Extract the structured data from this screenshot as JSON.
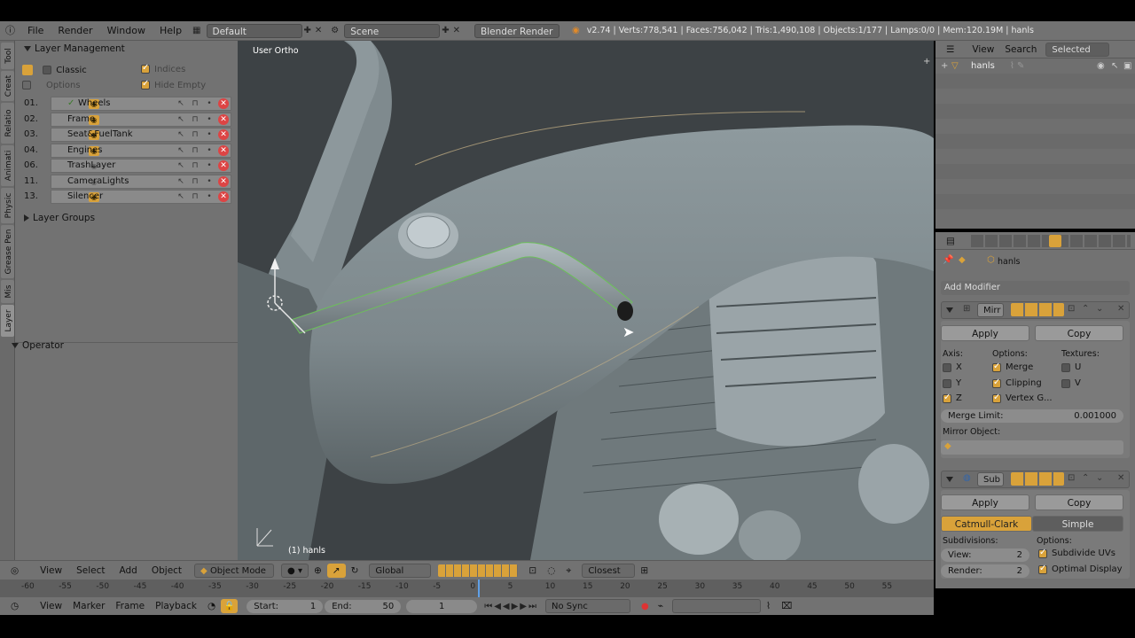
{
  "topbar": {
    "menus": [
      "File",
      "Render",
      "Window",
      "Help"
    ],
    "layout": "Default",
    "scene": "Scene",
    "engine": "Blender Render",
    "stats": "v2.74 | Verts:778,541 | Faces:756,042 | Tris:1,490,108 | Objects:1/177 | Lamps:0/0 | Mem:120.19M | hanls"
  },
  "lefttabs": [
    "Tool",
    "Creat",
    "Relatio",
    "Animati",
    "Physic",
    "Grease Pen",
    "Mis",
    "Layer"
  ],
  "layers": {
    "title": "Layer Management",
    "classic": "Classic",
    "indices": "Indices",
    "options": "Options",
    "hide_empty": "Hide Empty",
    "rows": [
      {
        "num": "01.",
        "name": "Wheels"
      },
      {
        "num": "02.",
        "name": "Frame"
      },
      {
        "num": "03.",
        "name": "Seat&FuelTank"
      },
      {
        "num": "04.",
        "name": "Engines"
      },
      {
        "num": "06.",
        "name": "TrashLayer"
      },
      {
        "num": "11.",
        "name": "CameraLights"
      },
      {
        "num": "13.",
        "name": "Silencer"
      }
    ],
    "groups": "Layer Groups",
    "operator": "Operator"
  },
  "viewport": {
    "view_label": "User Ortho",
    "object_label": "(1) hanls"
  },
  "vpheader": {
    "view": "View",
    "select": "Select",
    "add": "Add",
    "object": "Object",
    "mode": "Object Mode",
    "orientation": "Global",
    "snap": "Closest"
  },
  "timeline": {
    "ticks": [
      "-60",
      "-55",
      "-50",
      "-45",
      "-40",
      "-35",
      "-30",
      "-25",
      "-20",
      "-15",
      "-10",
      "-5",
      "0",
      "5",
      "10",
      "15",
      "20",
      "25",
      "30",
      "35",
      "40",
      "45",
      "50",
      "55"
    ],
    "view": "View",
    "marker": "Marker",
    "frame": "Frame",
    "playback": "Playback",
    "start_label": "Start:",
    "start": "1",
    "end_label": "End:",
    "end": "50",
    "current": "1",
    "sync": "No Sync"
  },
  "outliner": {
    "view": "View",
    "search": "Search",
    "filter": "Selected",
    "item": "hanls"
  },
  "props": {
    "object": "hanls",
    "add_modifier": "Add Modifier",
    "mirror": {
      "name": "Mirr",
      "apply": "Apply",
      "copy": "Copy",
      "axis": "Axis:",
      "options": "Options:",
      "textures": "Textures:",
      "x": "X",
      "y": "Y",
      "z": "Z",
      "merge": "Merge",
      "clipping": "Clipping",
      "vertex": "Vertex G...",
      "u": "U",
      "v": "V",
      "merge_limit_label": "Merge Limit:",
      "merge_limit": "0.001000",
      "mirror_object": "Mirror Object:"
    },
    "subsurf": {
      "name": "Sub",
      "apply": "Apply",
      "copy": "Copy",
      "catmull": "Catmull-Clark",
      "simple": "Simple",
      "subdivisions": "Subdivisions:",
      "options": "Options:",
      "view_label": "View:",
      "view": "2",
      "render_label": "Render:",
      "render": "2",
      "subdiv_uvs": "Subdivide UVs",
      "optimal": "Optimal Display"
    }
  }
}
